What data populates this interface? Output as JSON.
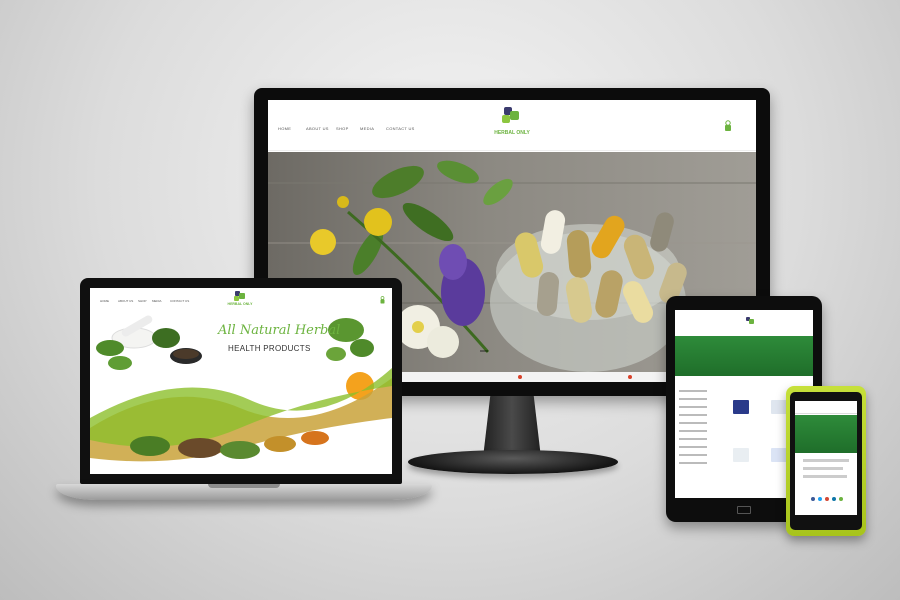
{
  "brand": {
    "accent": "#6cb33f",
    "dark_green": "#1f6e2a",
    "monitor_logo_text": "HERBAL ONLY",
    "monitor_logo_tagline": ""
  },
  "monitor": {
    "nav": [
      "HOME",
      "ABOUT US",
      "SHOP",
      "MEDIA",
      "CONTACT US"
    ],
    "hero_caption": "",
    "footer_links": [
      "",
      ""
    ]
  },
  "laptop": {
    "nav": [
      "HOME",
      "ABOUT US",
      "SHOP",
      "MEDIA",
      "CONTACT US"
    ],
    "logo_text": "HERBAL ONLY",
    "headline": "All Natural Herbal",
    "subline": "HEALTH PRODUCTS"
  },
  "tablet": {
    "nav": [
      "",
      "",
      "",
      "",
      ""
    ],
    "banner_title": "",
    "sidebar_heading": ""
  },
  "phone": {
    "header_text": ""
  },
  "icons": {
    "cart": "shopping-bag-icon",
    "logo": "leaf-logo-icon"
  }
}
